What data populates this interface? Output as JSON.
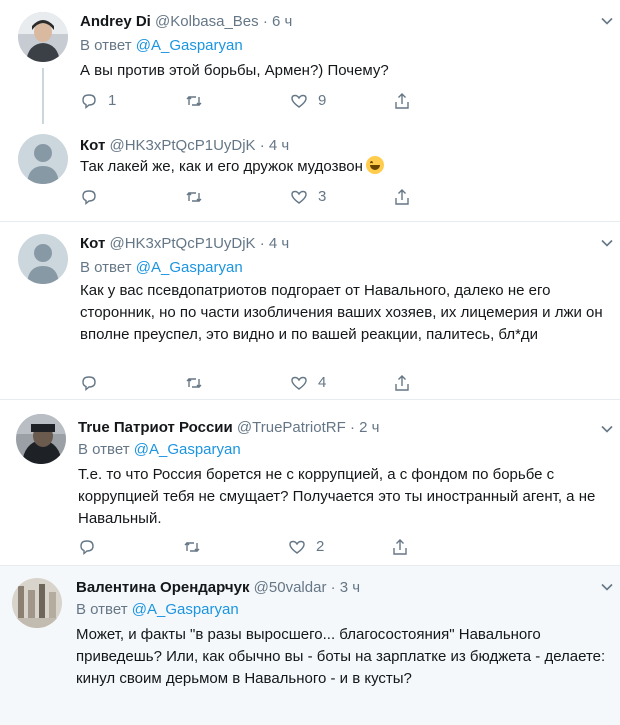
{
  "icons": {
    "reply": "speech-bubble-icon",
    "retweet": "retweet-icon",
    "like": "heart-icon",
    "share": "share-icon",
    "menu": "chevron-down-icon"
  },
  "colors": {
    "text": "#14171a",
    "secondary": "#657786",
    "link": "#1b95e0",
    "icon": "#657786"
  },
  "tweets": [
    {
      "name": "Andrey Di",
      "handle": "@Kolbasa_Bes",
      "time": "6 ч",
      "reply_prefix": "В ответ ",
      "reply_to": "@A_Gasparyan",
      "text": "А вы против этой борьбы, Армен?) Почему?",
      "reply_count": "1",
      "retweet_count": "",
      "like_count": "9"
    },
    {
      "name": "Кот",
      "handle": "@HK3xPtQcP1UyDjK",
      "time": "4 ч",
      "text": "Так лакей же, как и его дружок мудозвон",
      "reply_count": "",
      "retweet_count": "",
      "like_count": "3"
    },
    {
      "name": "Кот",
      "handle": "@HK3xPtQcP1UyDjK",
      "time": "4 ч",
      "reply_prefix": "В ответ ",
      "reply_to": "@A_Gasparyan",
      "text": "Как у вас псевдопатриотов подгорает от Навального, далеко не его сторонник, но по части изобличения ваших хозяев, их лицемерия и лжи он вполне преуспел, это видно и по вашей реакции, палитесь, бл*ди",
      "reply_count": "",
      "retweet_count": "",
      "like_count": "4"
    },
    {
      "name": "True Патриот России",
      "handle": "@TruePatriotRF",
      "time": "2 ч",
      "reply_prefix": "В ответ ",
      "reply_to": "@A_Gasparyan",
      "text": "Т.е. то что Россия борется не с коррупцией, а с фондом по борьбе с коррупцией тебя не смущает? Получается это ты иностранный агент, а не Навальный.",
      "reply_count": "",
      "retweet_count": "",
      "like_count": "2"
    },
    {
      "name": "Валентина Орендарчук",
      "handle": "@50valdar",
      "time": "3 ч",
      "reply_prefix": "В ответ ",
      "reply_to": "@A_Gasparyan",
      "text": "Может, и факты \"в разы выросшего... благосостояния\" Навального приведешь? Или, как обычно вы - боты на зарплатке из бюджета - делаете:  кинул своим дерьмом в Навального - и в кусты?"
    }
  ]
}
